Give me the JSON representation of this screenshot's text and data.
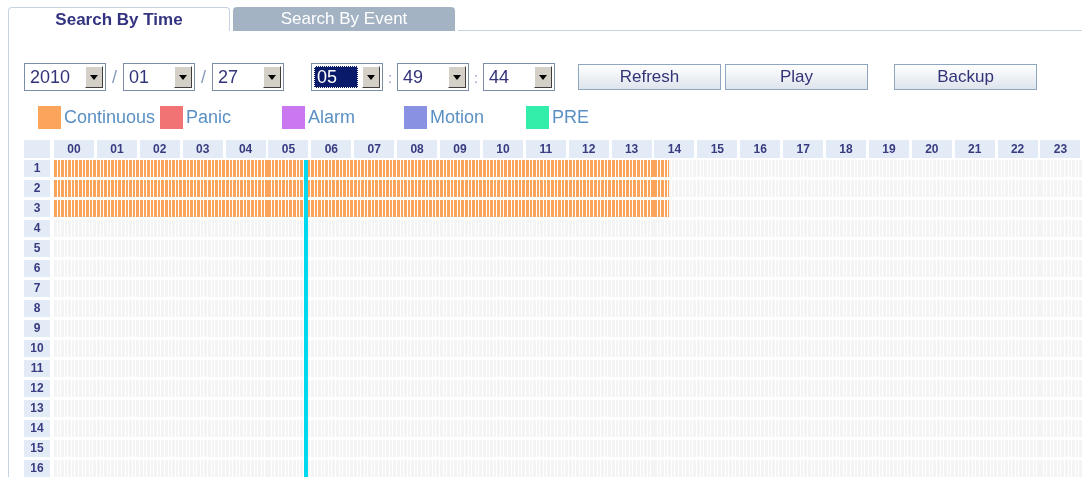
{
  "tabs": [
    {
      "label": "Search By Time",
      "selected": true
    },
    {
      "label": "Search By Event",
      "selected": false
    }
  ],
  "date_fields": [
    {
      "value": "2010",
      "focused": false
    },
    {
      "value": "01",
      "focused": false
    },
    {
      "value": "27",
      "focused": false
    }
  ],
  "date_separators": [
    "/",
    "/"
  ],
  "time_fields": [
    {
      "value": "05",
      "focused": true
    },
    {
      "value": "49",
      "focused": false
    },
    {
      "value": "44",
      "focused": false
    }
  ],
  "time_separators": [
    ":",
    ":"
  ],
  "buttons": [
    "Refresh",
    "Play",
    "Backup"
  ],
  "legend": [
    {
      "kind": "continuous",
      "label": "Continuous",
      "color": "#fba55c"
    },
    {
      "kind": "panic",
      "label": "Panic",
      "color": "#f27373"
    },
    {
      "kind": "alarm",
      "label": "Alarm",
      "color": "#cc77f2"
    },
    {
      "kind": "motion",
      "label": "Motion",
      "color": "#8891e2"
    },
    {
      "kind": "pre",
      "label": "PRE",
      "color": "#33eeaa"
    }
  ],
  "hours": [
    "00",
    "01",
    "02",
    "03",
    "04",
    "05",
    "06",
    "07",
    "08",
    "09",
    "10",
    "11",
    "12",
    "13",
    "14",
    "15",
    "16",
    "17",
    "18",
    "19",
    "20",
    "21",
    "22",
    "23"
  ],
  "channels": [
    {
      "label": "1",
      "hours": [
        {
          "kind": "continuous",
          "level": 1
        },
        {
          "kind": "continuous",
          "level": 1
        },
        {
          "kind": "continuous",
          "level": 1
        },
        {
          "kind": "continuous",
          "level": 1
        },
        {
          "kind": "continuous",
          "level": 1
        },
        {
          "kind": "continuous",
          "level": 1
        },
        {
          "kind": "continuous",
          "level": 1
        },
        {
          "kind": "continuous",
          "level": 1
        },
        {
          "kind": "continuous",
          "level": 1
        },
        {
          "kind": "continuous",
          "level": 1
        },
        {
          "kind": "continuous",
          "level": 1
        },
        {
          "kind": "continuous",
          "level": 1
        },
        {
          "kind": "continuous",
          "level": 1
        },
        {
          "kind": "continuous",
          "level": 1
        },
        {
          "kind": "continuous",
          "level": 0.34
        }
      ]
    },
    {
      "label": "2",
      "hours": [
        {
          "kind": "continuous",
          "level": 1
        },
        {
          "kind": "continuous",
          "level": 1
        },
        {
          "kind": "continuous",
          "level": 1
        },
        {
          "kind": "continuous",
          "level": 1
        },
        {
          "kind": "continuous",
          "level": 1
        },
        {
          "kind": "continuous",
          "level": 1
        },
        {
          "kind": "continuous",
          "level": 1
        },
        {
          "kind": "continuous",
          "level": 1
        },
        {
          "kind": "continuous",
          "level": 1
        },
        {
          "kind": "continuous",
          "level": 1
        },
        {
          "kind": "continuous",
          "level": 1
        },
        {
          "kind": "continuous",
          "level": 1
        },
        {
          "kind": "continuous",
          "level": 1
        },
        {
          "kind": "continuous",
          "level": 1
        },
        {
          "kind": "continuous",
          "level": 0.34
        }
      ]
    },
    {
      "label": "3",
      "hours": [
        {
          "kind": "continuous",
          "level": 1
        },
        {
          "kind": "continuous",
          "level": 1
        },
        {
          "kind": "continuous",
          "level": 1
        },
        {
          "kind": "continuous",
          "level": 1
        },
        {
          "kind": "continuous",
          "level": 1
        },
        {
          "kind": "continuous",
          "level": 1
        },
        {
          "kind": "continuous",
          "level": 1
        },
        {
          "kind": "continuous",
          "level": 1
        },
        {
          "kind": "continuous",
          "level": 1
        },
        {
          "kind": "continuous",
          "level": 1
        },
        {
          "kind": "continuous",
          "level": 1
        },
        {
          "kind": "continuous",
          "level": 1
        },
        {
          "kind": "continuous",
          "level": 1
        },
        {
          "kind": "continuous",
          "level": 1
        },
        {
          "kind": "continuous",
          "level": 0.34
        }
      ]
    },
    {
      "label": "4"
    },
    {
      "label": "5"
    },
    {
      "label": "6"
    },
    {
      "label": "7"
    },
    {
      "label": "8"
    },
    {
      "label": "9"
    },
    {
      "label": "10"
    },
    {
      "label": "11"
    },
    {
      "label": "12"
    },
    {
      "label": "13"
    },
    {
      "label": "14"
    },
    {
      "label": "15"
    },
    {
      "label": "16"
    }
  ]
}
